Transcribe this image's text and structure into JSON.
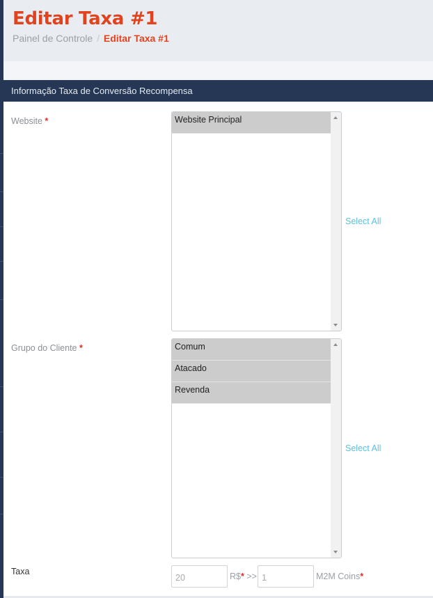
{
  "page": {
    "title": "Editar Taxa #1",
    "breadcrumb": {
      "home": "Painel de Controle",
      "separator": "/",
      "current": "Editar Taxa #1"
    }
  },
  "section": {
    "title": "Informação Taxa de Conversão Recompensa"
  },
  "form": {
    "website": {
      "label": "Website",
      "required_mark": "*",
      "options": [
        "Website Principal"
      ],
      "select_all": "Select All"
    },
    "customer_group": {
      "label": "Grupo do Cliente",
      "required_mark": "*",
      "options": [
        "Comum",
        "Atacado",
        "Revenda"
      ],
      "select_all": "Select All"
    },
    "rate": {
      "label": "Taxa",
      "value_from": "20",
      "currency": "R$",
      "required_mark": "*",
      "arrow": ">>",
      "value_to": "1",
      "points_label": "M2M Coins"
    }
  },
  "colors": {
    "accent": "#e1431f",
    "nav_dark": "#253754",
    "link": "#5bc0de",
    "selected_option": "#cccccc",
    "required": "#e02b27"
  }
}
